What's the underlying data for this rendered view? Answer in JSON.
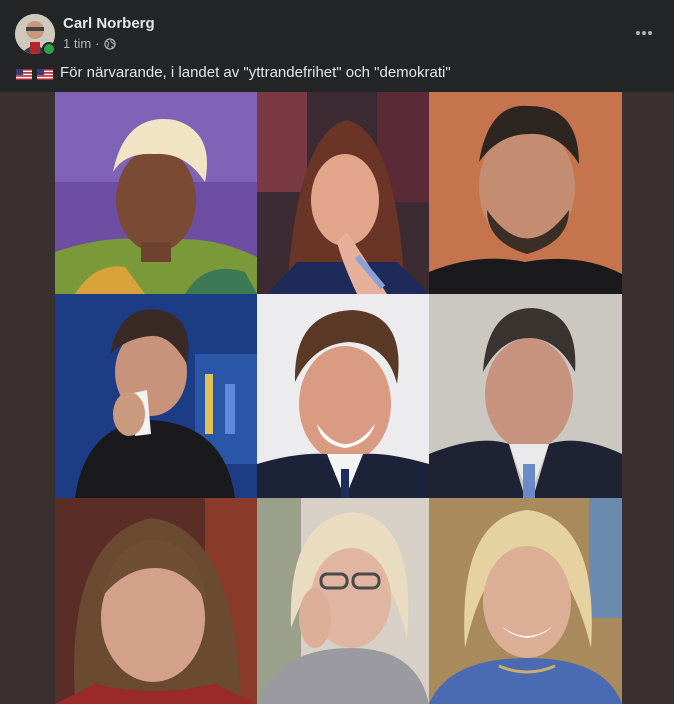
{
  "post": {
    "author": "Carl Norberg",
    "timestamp": "1 tim",
    "separator": "·",
    "privacy_icon": "globe-icon",
    "more_icon": "more-horizontal-icon",
    "caption_flags": [
      "us-flag-icon",
      "us-flag-icon"
    ],
    "caption_text": "För närvarande, i landet av \"yttrandefrihet\" och \"demokrati\""
  },
  "media": {
    "background": "#3a3030",
    "tiles": [
      {
        "name": "photo-tile-1",
        "bg": "#6a4a9c"
      },
      {
        "name": "photo-tile-2",
        "bg": "#3a2a30"
      },
      {
        "name": "photo-tile-3",
        "bg": "#c7744e"
      },
      {
        "name": "photo-tile-4",
        "bg": "#1a3a7a"
      },
      {
        "name": "photo-tile-5",
        "bg": "#e8e8ec"
      },
      {
        "name": "photo-tile-6",
        "bg": "#c9c6c0"
      },
      {
        "name": "photo-tile-7",
        "bg": "#7a2a20"
      },
      {
        "name": "photo-tile-8",
        "bg": "#d8cfc4"
      },
      {
        "name": "photo-tile-9",
        "bg": "#a58a5a"
      }
    ]
  },
  "colors": {
    "card": "#242526",
    "text": "#e4e6eb",
    "muted": "#b0b3b8",
    "online": "#31a24c"
  }
}
